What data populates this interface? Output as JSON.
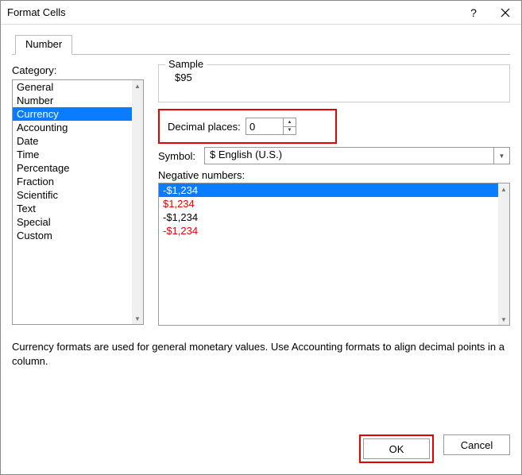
{
  "title": "Format Cells",
  "tab": "Number",
  "category_label": "Category:",
  "categories": [
    "General",
    "Number",
    "Currency",
    "Accounting",
    "Date",
    "Time",
    "Percentage",
    "Fraction",
    "Scientific",
    "Text",
    "Special",
    "Custom"
  ],
  "categories_selected_index": 2,
  "sample": {
    "label": "Sample",
    "value": "$95"
  },
  "decimal": {
    "label": "Decimal places:",
    "value": "0"
  },
  "symbol": {
    "label": "Symbol:",
    "value": "$ English (U.S.)"
  },
  "negative": {
    "label": "Negative numbers:",
    "items": [
      {
        "text": "-$1,234",
        "color": "white",
        "selected": true
      },
      {
        "text": "$1,234",
        "color": "red",
        "selected": false
      },
      {
        "text": "-$1,234",
        "color": "black",
        "selected": false
      },
      {
        "text": "-$1,234",
        "color": "red",
        "selected": false
      }
    ]
  },
  "description": "Currency formats are used for general monetary values.  Use Accounting formats to align decimal points in a column.",
  "buttons": {
    "ok": "OK",
    "cancel": "Cancel"
  }
}
